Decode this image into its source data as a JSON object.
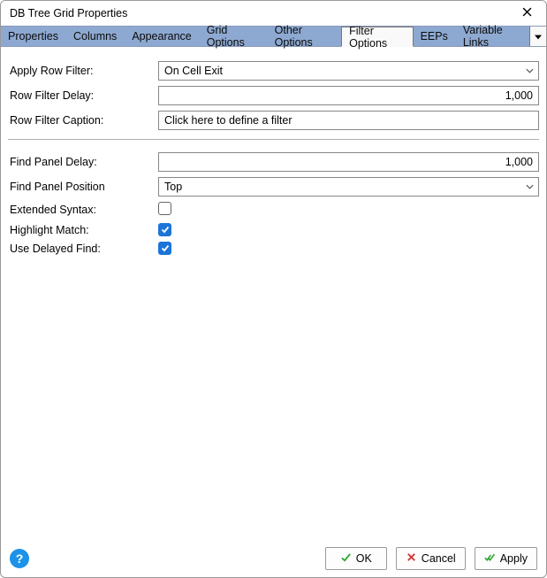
{
  "window": {
    "title": "DB Tree Grid Properties"
  },
  "tabs": {
    "items": [
      {
        "label": "Properties"
      },
      {
        "label": "Columns"
      },
      {
        "label": "Appearance"
      },
      {
        "label": "Grid Options"
      },
      {
        "label": "Other Options"
      },
      {
        "label": "Filter Options"
      },
      {
        "label": "EEPs"
      },
      {
        "label": "Variable Links"
      }
    ],
    "active_index": 5
  },
  "filter_options": {
    "apply_row_filter": {
      "label": "Apply Row Filter:",
      "value": "On Cell Exit"
    },
    "row_filter_delay": {
      "label": "Row Filter Delay:",
      "value": "1,000"
    },
    "row_filter_caption": {
      "label": "Row Filter Caption:",
      "value": "Click here to define a filter"
    },
    "find_panel_delay": {
      "label": "Find Panel Delay:",
      "value": "1,000"
    },
    "find_panel_position": {
      "label": "Find Panel Position",
      "value": "Top"
    },
    "extended_syntax": {
      "label": "Extended Syntax:",
      "checked": false
    },
    "highlight_match": {
      "label": "Highlight Match:",
      "checked": true
    },
    "use_delayed_find": {
      "label": "Use Delayed Find:",
      "checked": true
    }
  },
  "footer": {
    "help": "?",
    "ok": "OK",
    "cancel": "Cancel",
    "apply": "Apply"
  },
  "colors": {
    "tabbar_bg": "#8ea9d1",
    "accent_blue": "#1c74d8",
    "ok_green": "#2fa52f",
    "cancel_red": "#d23a3a"
  }
}
